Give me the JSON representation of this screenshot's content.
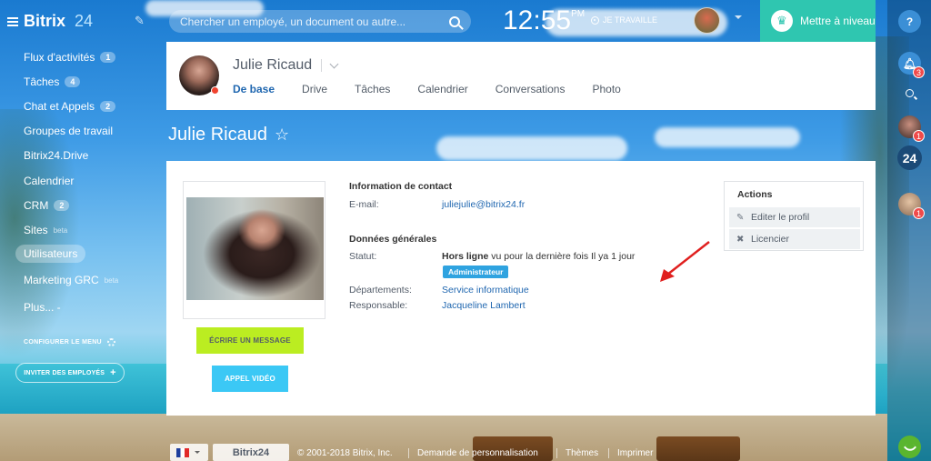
{
  "header": {
    "logo": "Bitrix",
    "logo_num": "24",
    "search_placeholder": "Chercher un employé, un document ou autre...",
    "clock": "12:55",
    "clock_suffix": "PM",
    "work_status": "JE TRAVAILLE",
    "upgrade_label": "Mettre à niveau"
  },
  "sidebar": {
    "items": [
      {
        "label": "Flux d'activités",
        "count": "1"
      },
      {
        "label": "Tâches",
        "count": "4"
      },
      {
        "label": "Chat et Appels",
        "count": "2"
      },
      {
        "label": "Groupes de travail"
      },
      {
        "label": "Bitrix24.Drive"
      },
      {
        "label": "Calendrier"
      },
      {
        "label": "CRM",
        "count": "2"
      },
      {
        "label": "Sites",
        "sup": "beta"
      },
      {
        "label": "Utilisateurs"
      },
      {
        "label": "Marketing GRC",
        "sup": "beta"
      },
      {
        "label": "Plus... -"
      }
    ],
    "configure": "CONFIGURER LE MENU",
    "invite": "INVITER DES EMPLOYÉS"
  },
  "right_panel": {
    "help": "?",
    "notifications_count": "3",
    "app_badge": "24",
    "chat1_count": "1",
    "chat2_count": "1"
  },
  "profile_header": {
    "name": "Julie Ricaud",
    "tabs": [
      "De base",
      "Drive",
      "Tâches",
      "Calendrier",
      "Conversations",
      "Photo"
    ]
  },
  "page_title": "Julie Ricaud",
  "main": {
    "btn_message": "ÉCRIRE UN MESSAGE",
    "btn_video": "APPEL VIDÉO",
    "contact_title": "Information de contact",
    "email_label": "E-mail:",
    "email_value": "juliejulie@bitrix24.fr",
    "general_title": "Données générales",
    "status_label": "Statut:",
    "status_bold": "Hors ligne",
    "status_rest": " vu pour la dernière fois Il ya 1 jour",
    "role_badge": "Administrateur",
    "dept_label": "Départements:",
    "dept_value": "Service informatique",
    "manager_label": "Responsable:",
    "manager_value": "Jacqueline Lambert"
  },
  "actions": {
    "title": "Actions",
    "edit": "Editer le profil",
    "fire": "Licencier"
  },
  "footer": {
    "logo": "Bitrix24",
    "copyright": "© 2001-2018 Bitrix, Inc.",
    "request": "Demande de personnalisation",
    "themes": "Thèmes",
    "print": "Imprimer"
  },
  "colors": {
    "accent_blue": "#2067b0",
    "upgrade_teal": "#2fc6b0",
    "message_green": "#bbed21",
    "video_blue": "#3bc8f5",
    "admin_badge": "#2fa3e0",
    "alert_red": "#f04a4a"
  }
}
